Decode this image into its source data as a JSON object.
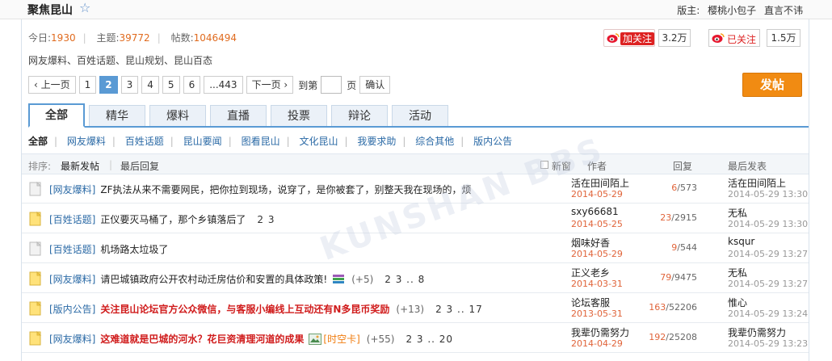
{
  "header": {
    "forum_title": "聚焦昆山",
    "moderator_label": "版主:",
    "moderators": [
      "樱桃小包子",
      "直言不讳"
    ]
  },
  "stats": {
    "today_label": "今日:",
    "today": "1930",
    "topics_label": "主题:",
    "topics": "39772",
    "posts_label": "帖数:",
    "posts": "1046494"
  },
  "categories_text": "网友爆料、百姓话题、昆山规划、昆山百态",
  "follow": {
    "follow_label": "加关注",
    "follow_count": "3.2万",
    "followed_label": "已关注",
    "followed_count": "1.5万"
  },
  "pager": {
    "prev": "上一页",
    "pages": [
      "1",
      "2",
      "3",
      "4",
      "5",
      "6",
      "...443"
    ],
    "current": "2",
    "next": "下一页",
    "goto": "到第",
    "page_unit": "页",
    "confirm": "确认"
  },
  "post_button": "发帖",
  "tabs": [
    "全部",
    "精华",
    "爆料",
    "直播",
    "投票",
    "辩论",
    "活动"
  ],
  "subnav": [
    "全部",
    "网友爆料",
    "百姓话题",
    "昆山要闻",
    "图看昆山",
    "文化昆山",
    "我要求助",
    "综合其他",
    "版内公告"
  ],
  "sortbar": {
    "label": "排序:",
    "newest": "最新发帖",
    "last_reply": "最后回复",
    "new_window": "新窗",
    "author": "作者",
    "replies": "回复",
    "last_post": "最后发表"
  },
  "threads": [
    {
      "cat": "[网友爆料]",
      "title": "ZF执法从来不需要网民，把你拉到现场，说穿了，是你被套了，别整天我在现场的，烦",
      "author": "活在田间陌上",
      "date": "2014-05-29",
      "replies": "6",
      "views": "573",
      "last_user": "活在田间陌上",
      "last_time": "2014-05-29 13:30"
    },
    {
      "cat": "[百姓话题]",
      "title": "正仪要灭马桶了，那个乡镇落后了",
      "pages": "2 3",
      "author": "sxy66681",
      "date": "2014-05-25",
      "replies": "23",
      "views": "2915",
      "last_user": "无私",
      "last_time": "2014-05-29 13:30"
    },
    {
      "cat": "[百姓话题]",
      "title": "机场路太垃圾了",
      "author": "烟味好香",
      "date": "2014-05-29",
      "replies": "9",
      "views": "544",
      "last_user": "ksqur",
      "last_time": "2014-05-29 13:27"
    },
    {
      "cat": "[网友爆料]",
      "title": "请巴城镇政府公开农村动迁房估价和安置的具体政策!",
      "extra": "(+5)",
      "pages": "2 3 .. 8",
      "author": "正义老乡",
      "date": "2014-03-31",
      "replies": "79",
      "views": "9475",
      "last_user": "无私",
      "last_time": "2014-05-29 13:27"
    },
    {
      "cat": "[版内公告]",
      "title": "关注昆山论坛官方公众微信，与客服小编线上互动还有N多昆币奖励",
      "extra": "(+13)",
      "pages": "2 3 .. 17",
      "author": "论坛客服",
      "date": "2013-05-31",
      "replies": "163",
      "views": "52206",
      "last_user": "惟心",
      "last_time": "2014-05-29 13:24"
    },
    {
      "cat": "[网友爆料]",
      "title": "这难道就是巴城的河水？花巨资清理河道的成果",
      "time_card": "[时空卡]",
      "extra": "(+55)",
      "pages": "2 3 .. 20",
      "author": "我辈仍需努力",
      "date": "2014-04-29",
      "replies": "192",
      "views": "25208",
      "last_user": "我辈仍需努力",
      "last_time": "2014-05-29 13:23"
    }
  ],
  "watermark": "KUNSHAN BBS"
}
